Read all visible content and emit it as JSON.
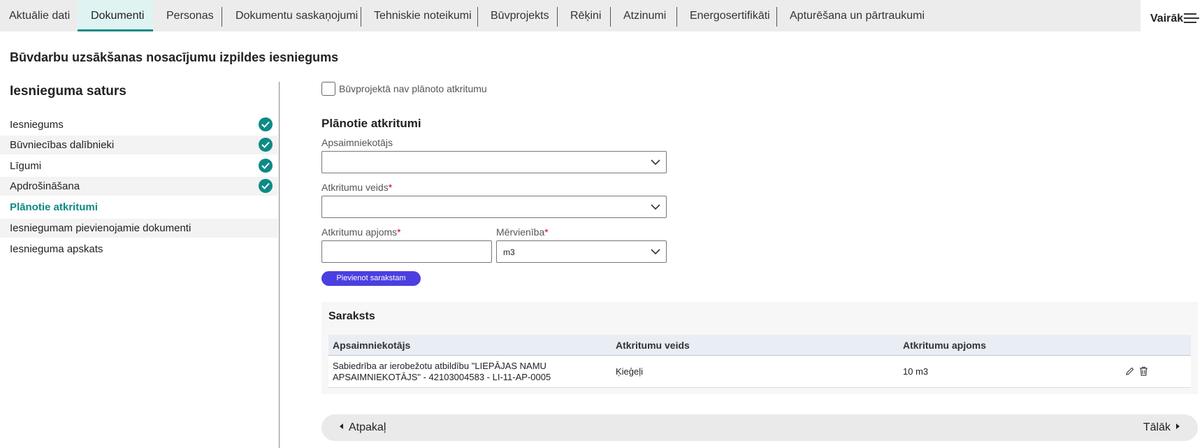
{
  "tabs": [
    {
      "label": "Aktuālie dati"
    },
    {
      "label": "Dokumenti",
      "active": true
    },
    {
      "label": "Personas"
    },
    {
      "label": "Dokumentu saskaņojumi"
    },
    {
      "label": "Tehniskie noteikumi"
    },
    {
      "label": "Būvprojekts"
    },
    {
      "label": "Rēķini"
    },
    {
      "label": "Atzinumi"
    },
    {
      "label": "Energosertifikāti"
    },
    {
      "label": "Apturēšana un pārtraukumi"
    }
  ],
  "more_label": "Vairāk",
  "page_title": "Būvdarbu uzsākšanas nosacījumu izpildes iesniegums",
  "sidebar": {
    "title": "Iesnieguma saturs",
    "items": [
      {
        "label": "Iesniegums",
        "completed": true
      },
      {
        "label": "Būvniecības dalībnieki",
        "completed": true
      },
      {
        "label": "Līgumi",
        "completed": true
      },
      {
        "label": "Apdrošināšana",
        "completed": true
      },
      {
        "label": "Plānotie atkritumi",
        "current": true
      },
      {
        "label": "Iesniegumam pievienojamie dokumenti"
      },
      {
        "label": "Iesnieguma apskats"
      }
    ]
  },
  "form": {
    "no_waste_checkbox": {
      "label": "Būvprojektā nav plānoto atkritumu",
      "checked": false
    },
    "section_title": "Plānotie atkritumi",
    "manager": {
      "label": "Apsaimniekotājs",
      "value": ""
    },
    "waste_type": {
      "label": "Atkritumu veids",
      "required_mark": "*",
      "value": ""
    },
    "amount": {
      "label": "Atkritumu apjoms",
      "required_mark": "*",
      "value": ""
    },
    "unit": {
      "label": "Mērvienība",
      "required_mark": "*",
      "value": "m3"
    },
    "add_button": "Pievienot sarakstam"
  },
  "list": {
    "title": "Saraksts",
    "columns": [
      "Apsaimniekotājs",
      "Atkritumu veids",
      "Atkritumu apjoms"
    ],
    "rows": [
      {
        "manager_line1": "Sabiedrība ar ierobežotu atbildību \"LIEPĀJAS NAMU",
        "manager_line2": "APSAIMNIEKOTĀJS\" - 42103004583 - LI-11-AP-0005",
        "waste_type": "Ķieģeļi",
        "amount": "10 m3"
      }
    ]
  },
  "nav": {
    "back": "Atpakaļ",
    "next": "Tālāk"
  },
  "colors": {
    "accent": "#0e8a86",
    "button": "#4b3fe0",
    "required": "#d0021b"
  }
}
